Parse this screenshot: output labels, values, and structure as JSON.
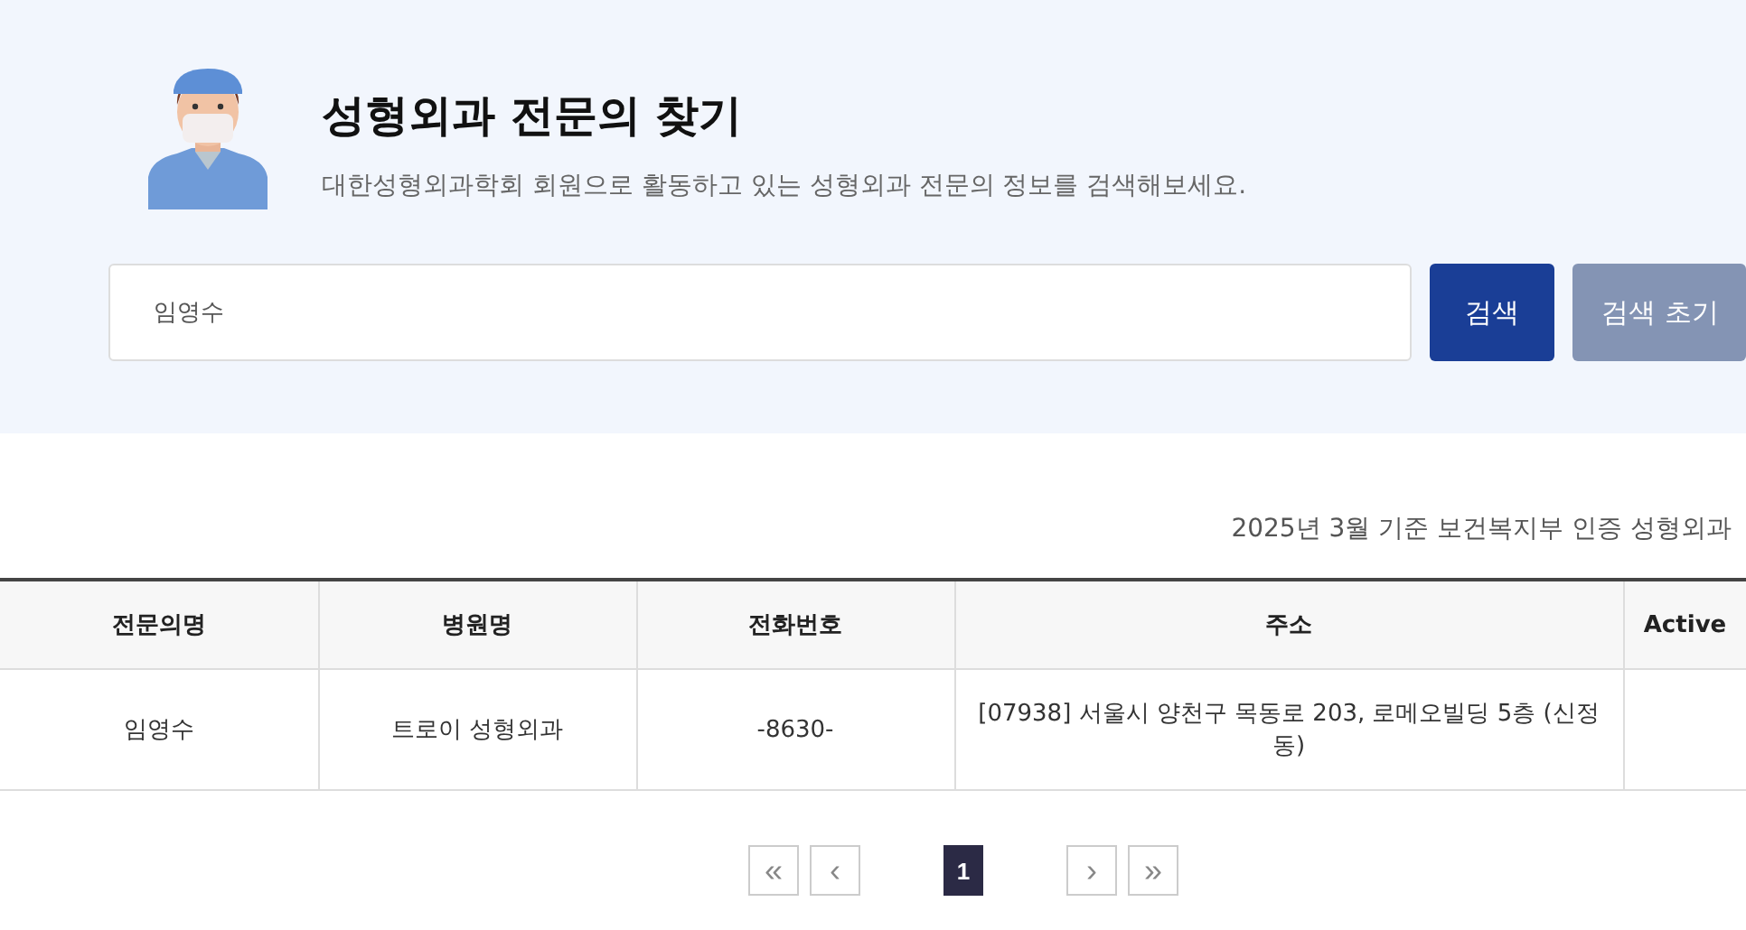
{
  "header": {
    "title": "성형외과 전문의 찾기",
    "subtitle": "대한성형외과학회 회원으로 활동하고 있는 성형외과 전문의 정보를 검색해보세요."
  },
  "search": {
    "value": "임영수",
    "buttons": [
      {
        "label": "검색",
        "kind": "primary"
      },
      {
        "label": "검색 초기",
        "kind": "secondary"
      }
    ]
  },
  "notice": "2025년 3월 기준 보건복지부 인증 성형외과",
  "table": {
    "columns": [
      "전문의명",
      "병원명",
      "전화번호",
      "주소",
      "Active"
    ],
    "rows": [
      [
        "임영수",
        "트로이 성형외과",
        "-8630-",
        "[07938] 서울시 양천구 목동로 203, 로메오빌딩 5층 (신정동)",
        ""
      ]
    ]
  },
  "pagination": {
    "first": "«",
    "prev": "‹",
    "pages": [
      {
        "label": "1",
        "selected": true
      }
    ],
    "next": "›",
    "last": "»"
  }
}
